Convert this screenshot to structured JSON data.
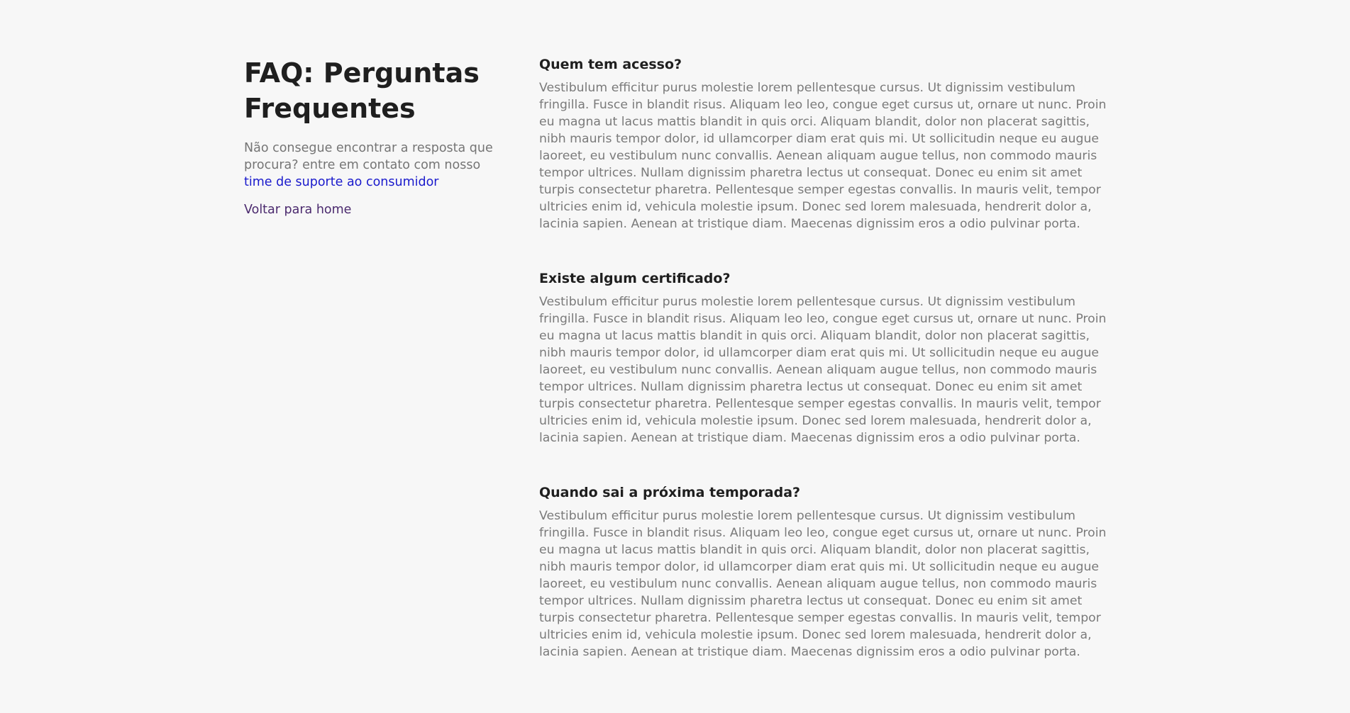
{
  "sidebar": {
    "title": "FAQ: Perguntas Frequentes",
    "intro_text": "Não consegue encontrar a resposta que procura? entre em contato com nosso ",
    "support_link": "time de suporte ao consumidor",
    "back_link": "Voltar para home"
  },
  "faq": [
    {
      "question": "Quem tem acesso?",
      "answer": "Vestibulum efficitur purus molestie lorem pellentesque cursus. Ut dignissim vestibulum fringilla. Fusce in blandit risus. Aliquam leo leo, congue eget cursus ut, ornare ut nunc. Proin eu magna ut lacus mattis blandit in quis orci. Aliquam blandit, dolor non placerat sagittis, nibh mauris tempor dolor, id ullamcorper diam erat quis mi. Ut sollicitudin neque eu augue laoreet, eu vestibulum nunc convallis. Aenean aliquam augue tellus, non commodo mauris tempor ultrices. Nullam dignissim pharetra lectus ut consequat. Donec eu enim sit amet turpis consectetur pharetra. Pellentesque semper egestas convallis. In mauris velit, tempor ultricies enim id, vehicula molestie ipsum. Donec sed lorem malesuada, hendrerit dolor a, lacinia sapien. Aenean at tristique diam. Maecenas dignissim eros a odio pulvinar porta."
    },
    {
      "question": "Existe algum certificado?",
      "answer": "Vestibulum efficitur purus molestie lorem pellentesque cursus. Ut dignissim vestibulum fringilla. Fusce in blandit risus. Aliquam leo leo, congue eget cursus ut, ornare ut nunc. Proin eu magna ut lacus mattis blandit in quis orci. Aliquam blandit, dolor non placerat sagittis, nibh mauris tempor dolor, id ullamcorper diam erat quis mi. Ut sollicitudin neque eu augue laoreet, eu vestibulum nunc convallis. Aenean aliquam augue tellus, non commodo mauris tempor ultrices. Nullam dignissim pharetra lectus ut consequat. Donec eu enim sit amet turpis consectetur pharetra. Pellentesque semper egestas convallis. In mauris velit, tempor ultricies enim id, vehicula molestie ipsum. Donec sed lorem malesuada, hendrerit dolor a, lacinia sapien. Aenean at tristique diam. Maecenas dignissim eros a odio pulvinar porta."
    },
    {
      "question": "Quando sai a próxima temporada?",
      "answer": "Vestibulum efficitur purus molestie lorem pellentesque cursus. Ut dignissim vestibulum fringilla. Fusce in blandit risus. Aliquam leo leo, congue eget cursus ut, ornare ut nunc. Proin eu magna ut lacus mattis blandit in quis orci. Aliquam blandit, dolor non placerat sagittis, nibh mauris tempor dolor, id ullamcorper diam erat quis mi. Ut sollicitudin neque eu augue laoreet, eu vestibulum nunc convallis. Aenean aliquam augue tellus, non commodo mauris tempor ultrices. Nullam dignissim pharetra lectus ut consequat. Donec eu enim sit amet turpis consectetur pharetra. Pellentesque semper egestas convallis. In mauris velit, tempor ultricies enim id, vehicula molestie ipsum. Donec sed lorem malesuada, hendrerit dolor a, lacinia sapien. Aenean at tristique diam. Maecenas dignissim eros a odio pulvinar porta."
    }
  ]
}
